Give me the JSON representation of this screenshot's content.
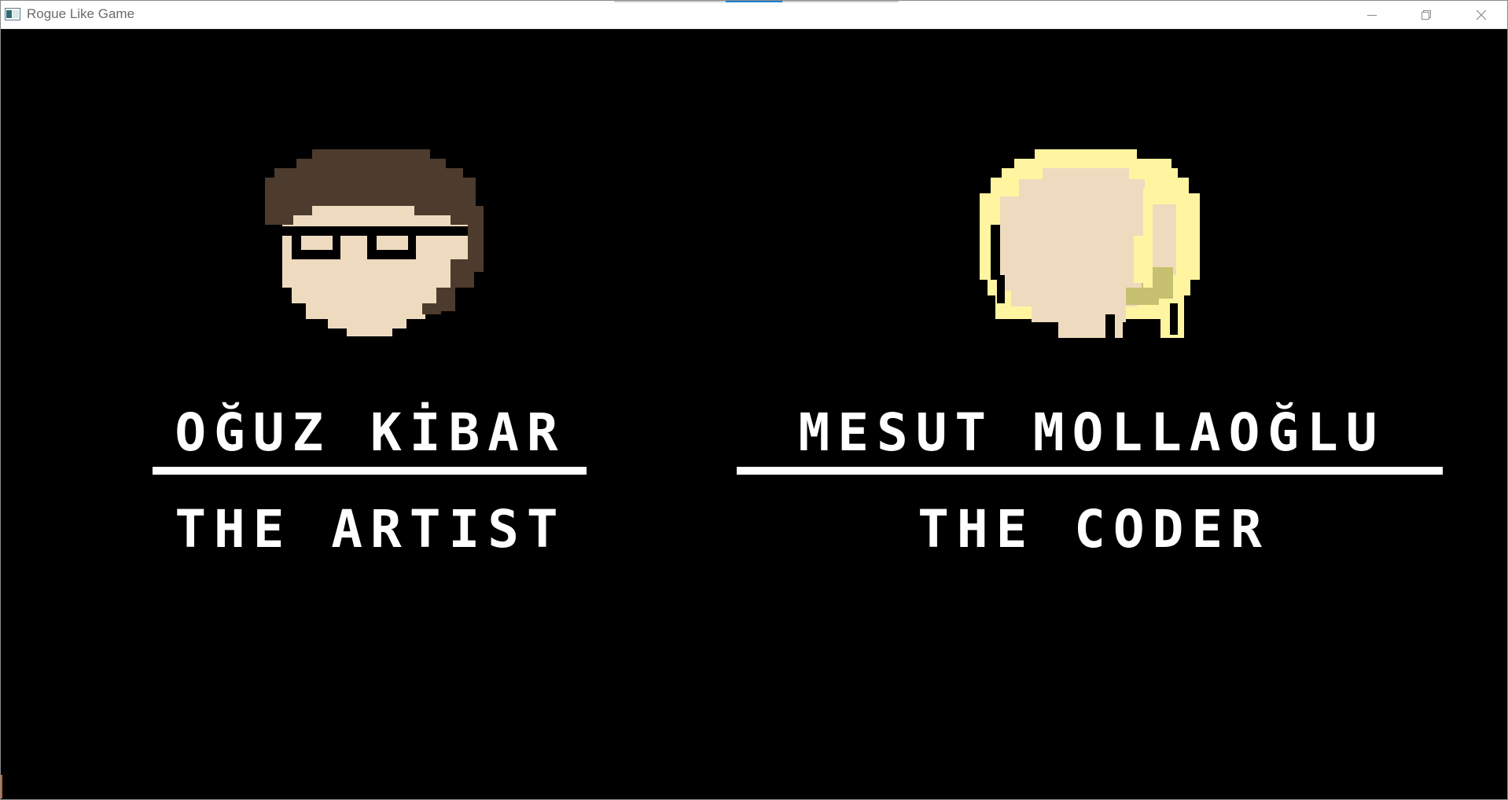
{
  "window": {
    "title": "Rogue Like Game"
  },
  "credits": [
    {
      "name": "OĞUZ KİBAR",
      "role": "THE ARTIST",
      "avatar": "artist-portrait-brown-hair-glasses"
    },
    {
      "name": "MESUT MOLLAOĞLU",
      "role": "THE CODER",
      "avatar": "coder-portrait-blonde-hair"
    }
  ],
  "colors": {
    "background": "#000000",
    "text": "#ffffff",
    "skin": "#eedbbf",
    "brown_hair": "#4d3b2d",
    "blonde_hair": "#fff5a0",
    "blonde_shade": "#c7c070"
  }
}
